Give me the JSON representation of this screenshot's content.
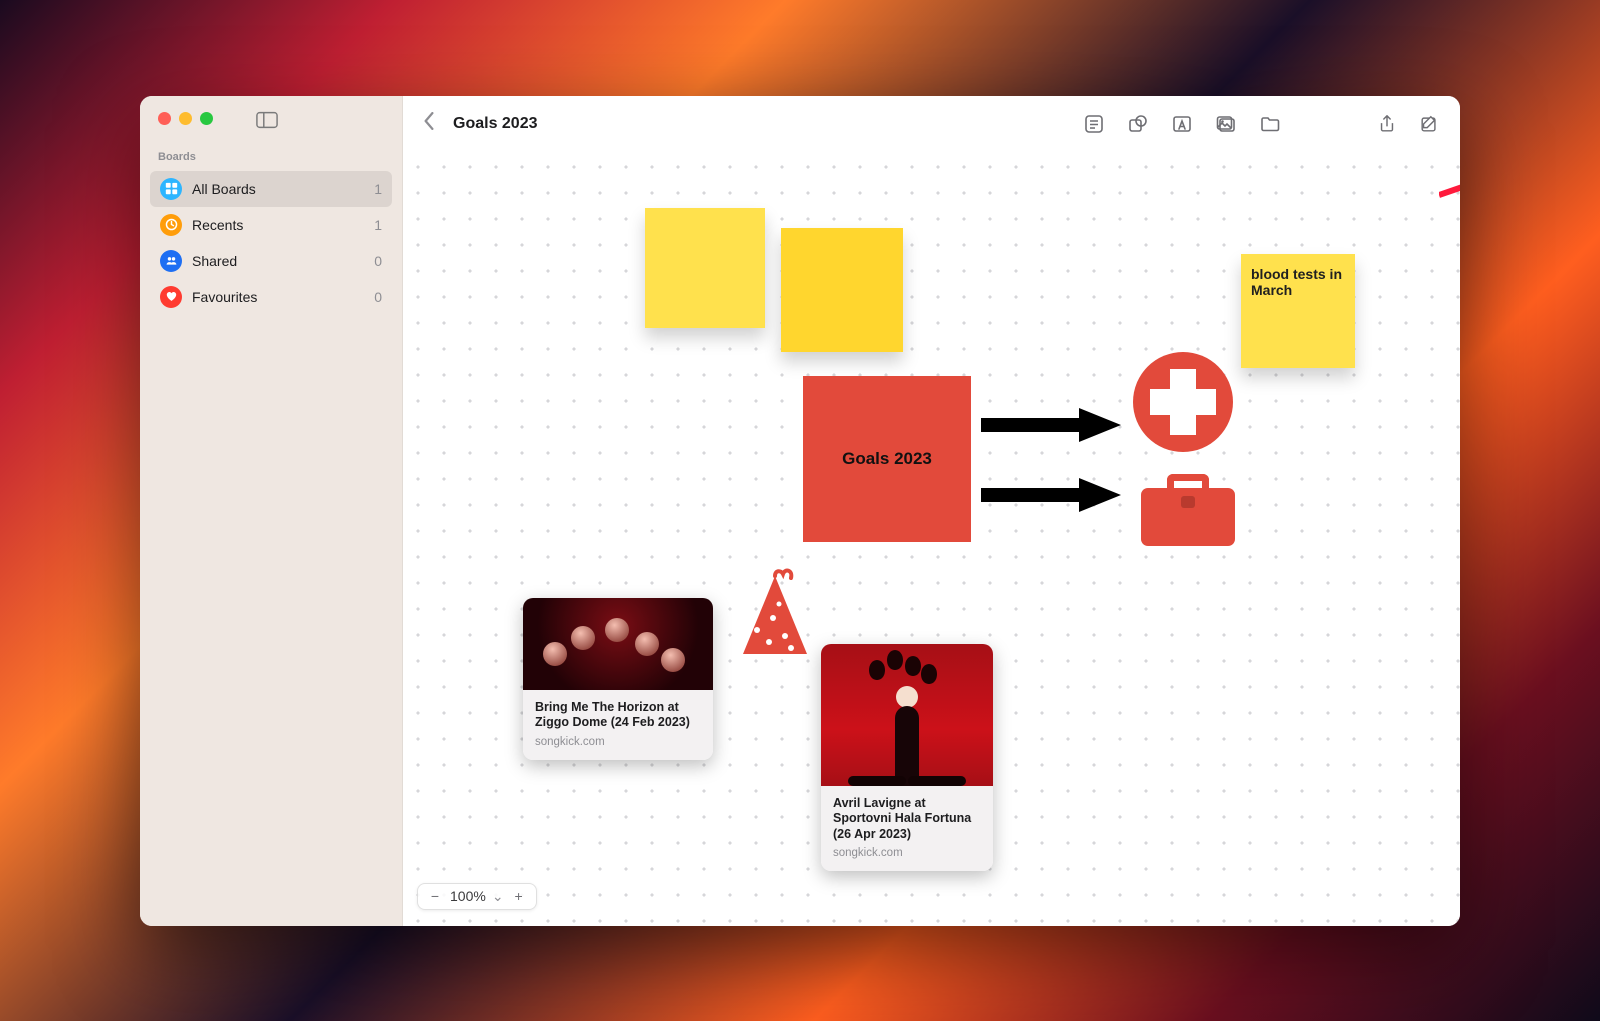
{
  "sidebar": {
    "section": "Boards",
    "items": [
      {
        "label": "All Boards",
        "count": "1",
        "icon": "grid"
      },
      {
        "label": "Recents",
        "count": "1",
        "icon": "clock"
      },
      {
        "label": "Shared",
        "count": "0",
        "icon": "people"
      },
      {
        "label": "Favourites",
        "count": "0",
        "icon": "heart"
      }
    ]
  },
  "header": {
    "title": "Goals 2023"
  },
  "canvas": {
    "goal_block": "Goals 2023",
    "sticky_blood": "blood tests in March"
  },
  "cards": [
    {
      "title": "Bring Me The Horizon at Ziggo Dome (24 Feb 2023)",
      "source": "songkick.com"
    },
    {
      "title": "Avril Lavigne at Sportovni Hala Fortuna (26 Apr 2023)",
      "source": "songkick.com"
    }
  ],
  "zoom": "100%",
  "icons": {
    "note": "note-icon",
    "shape": "shape-icon",
    "text": "text-icon",
    "image": "image-icon",
    "file": "file-icon",
    "share": "share-icon",
    "compose": "compose-icon"
  }
}
